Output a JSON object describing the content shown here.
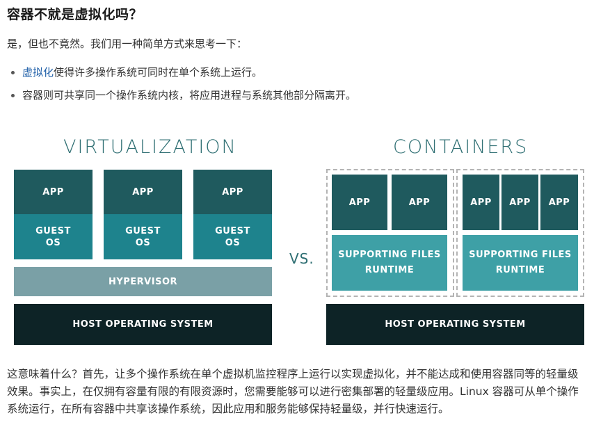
{
  "title": "容器不就是虚拟化吗？",
  "intro": "是，但也不竟然。我们用一种简单方式来思考一下：",
  "bullets": [
    {
      "link": "虚拟化",
      "text": "使得许多操作系统可同时在单个系统上运行。"
    },
    {
      "link": "",
      "text": "容器则可共享同一个操作系统内核，将应用进程与系统其他部分隔离开。"
    }
  ],
  "diagram": {
    "virt_heading": "VIRTUALIZATION",
    "cont_heading": "CONTAINERS",
    "vs": "VS.",
    "app": "APP",
    "guest_line1": "GUEST",
    "guest_line2": "OS",
    "hypervisor": "HYPERVISOR",
    "host": "HOST OPERATING SYSTEM",
    "support_line1": "SUPPORTING FILES",
    "support_line2": "RUNTIME"
  },
  "outro": "这意味着什么？首先，让多个操作系统在单个虚拟机监控程序上运行以实现虚拟化，并不能达成和使用容器同等的轻量级效果。事实上，在仅拥有容量有限的有限资源时，您需要能够可以进行密集部署的轻量级应用。Linux 容器可从单个操作系统运行，在所有容器中共享该操作系统，因此应用和服务能够保持轻量级，并行快速运行。",
  "colors": {
    "app": "#1f5a5e",
    "guest_os": "#1e838d",
    "hypervisor": "#7aa0a6",
    "host_os": "#0d2326",
    "supporting_files": "#3ea0a6",
    "heading": "#2f6f73",
    "link": "#1f5fa8"
  }
}
